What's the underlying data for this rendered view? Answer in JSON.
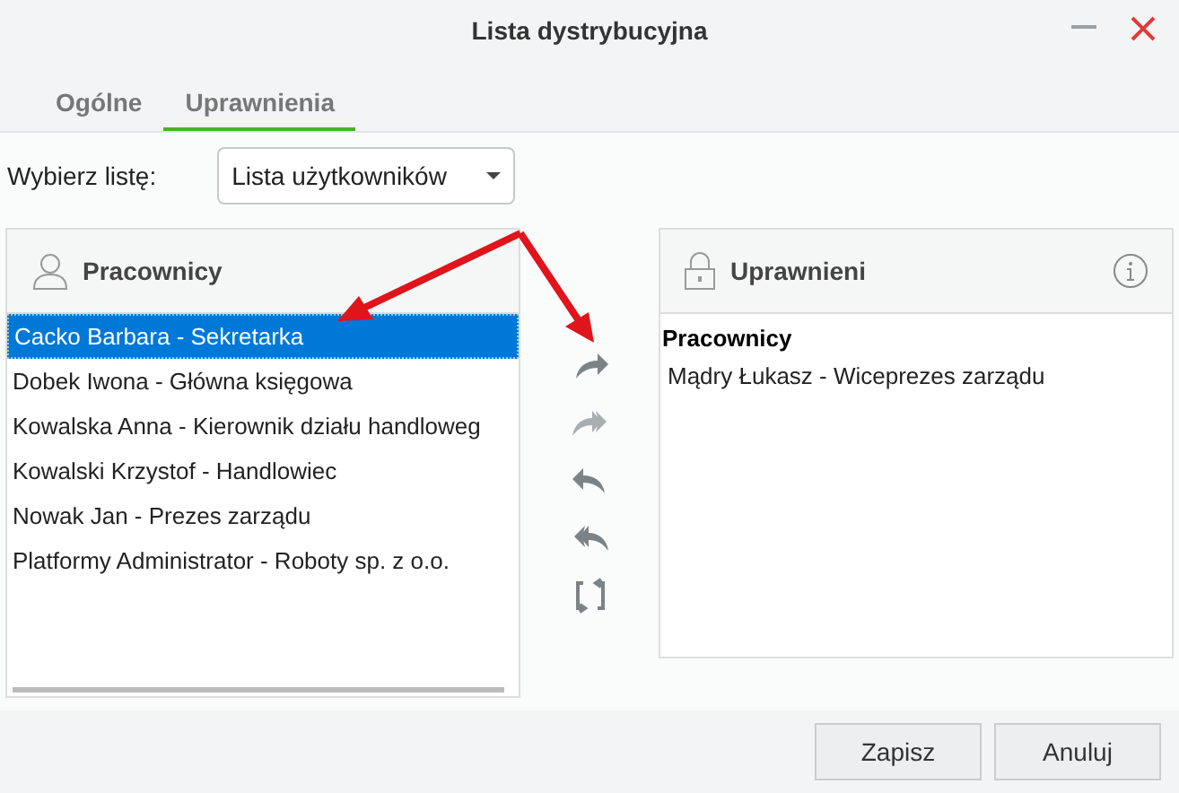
{
  "window": {
    "title": "Lista dystrybucyjna"
  },
  "tabs": [
    {
      "label": "Ogólne",
      "selected": false
    },
    {
      "label": "Uprawnienia",
      "selected": true
    }
  ],
  "list_picker": {
    "label": "Wybierz listę:",
    "value": "Lista użytkowników"
  },
  "employees_panel": {
    "title": "Pracownicy",
    "items": [
      {
        "label": "Cacko Barbara - Sekretarka",
        "selected": true
      },
      {
        "label": "Dobek Iwona - Główna księgowa",
        "selected": false
      },
      {
        "label": "Kowalska Anna - Kierownik działu handloweg",
        "selected": false
      },
      {
        "label": "Kowalski Krzystof - Handlowiec",
        "selected": false
      },
      {
        "label": "Nowak Jan - Prezes zarządu",
        "selected": false
      },
      {
        "label": "Platformy Administrator - Roboty sp. z o.o.",
        "selected": false
      }
    ]
  },
  "authorized_panel": {
    "title": "Uprawnieni",
    "groups": [
      {
        "title": "Pracownicy",
        "items": [
          "Mądry Łukasz - Wiceprezes zarządu"
        ]
      }
    ]
  },
  "buttons": [
    "Zapisz",
    "Anuluj"
  ]
}
